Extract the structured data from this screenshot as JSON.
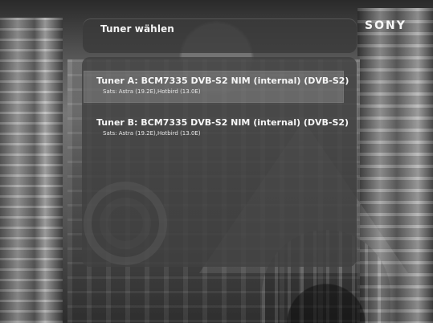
{
  "header": {
    "title": "Tuner wählen",
    "brand": "SONY"
  },
  "tuners": [
    {
      "label": "Tuner A: BCM7335 DVB-S2 NIM (internal) (DVB-S2)",
      "sats": "Sats: Astra (19.2E),Hotbird (13.0E)",
      "selected": true
    },
    {
      "label": "Tuner B: BCM7335 DVB-S2 NIM (internal) (DVB-S2)",
      "sats": "Sats: Astra (19.2E),Hotbird (13.0E)",
      "selected": false
    }
  ]
}
